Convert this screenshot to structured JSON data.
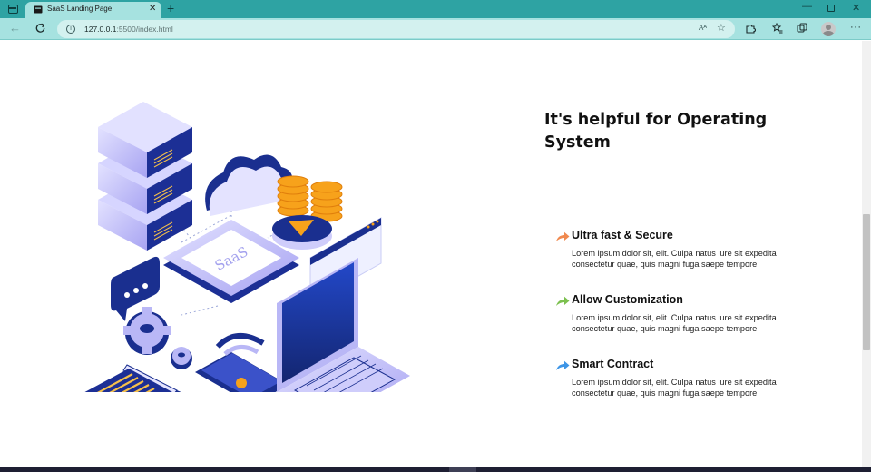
{
  "browser": {
    "tab_title": "SaaS Landing Page",
    "tab_close": "✕",
    "new_tab": "+",
    "url_host": "127.0.0.1",
    "url_rest": ":5500/index.html",
    "back_glyph": "←",
    "min_glyph": "—",
    "close_glyph": "✕",
    "more_glyph": "···",
    "read_aloud": "Aᴬ",
    "favorite_glyph": "☆"
  },
  "illustration": {
    "label": "SaaS"
  },
  "section": {
    "heading": "It's helpful for Operating System",
    "features": [
      {
        "title": "Ultra fast & Secure",
        "description": "Lorem ipsum dolor sit, elit. Culpa natus iure sit expedita consectetur quae, quis magni fuga saepe tempore.",
        "icon": "arrow-icon",
        "color": "#f0894f"
      },
      {
        "title": "Allow Customization",
        "description": "Lorem ipsum dolor sit, elit. Culpa natus iure sit expedita consectetur quae, quis magni fuga saepe tempore.",
        "icon": "arrow-icon",
        "color": "#7cc04f"
      },
      {
        "title": "Smart Contract",
        "description": "Lorem ipsum dolor sit, elit. Culpa natus iure sit expedita consectetur quae, quis magni fuga saepe tempore.",
        "icon": "arrow-icon",
        "color": "#3d95e6"
      }
    ]
  },
  "colors": {
    "chrome": "#2ea3a3",
    "toolbar": "#a6e2e0",
    "navy": "#1a2f8f",
    "lavender": "#b9b7f6",
    "coin": "#f7a21b"
  }
}
